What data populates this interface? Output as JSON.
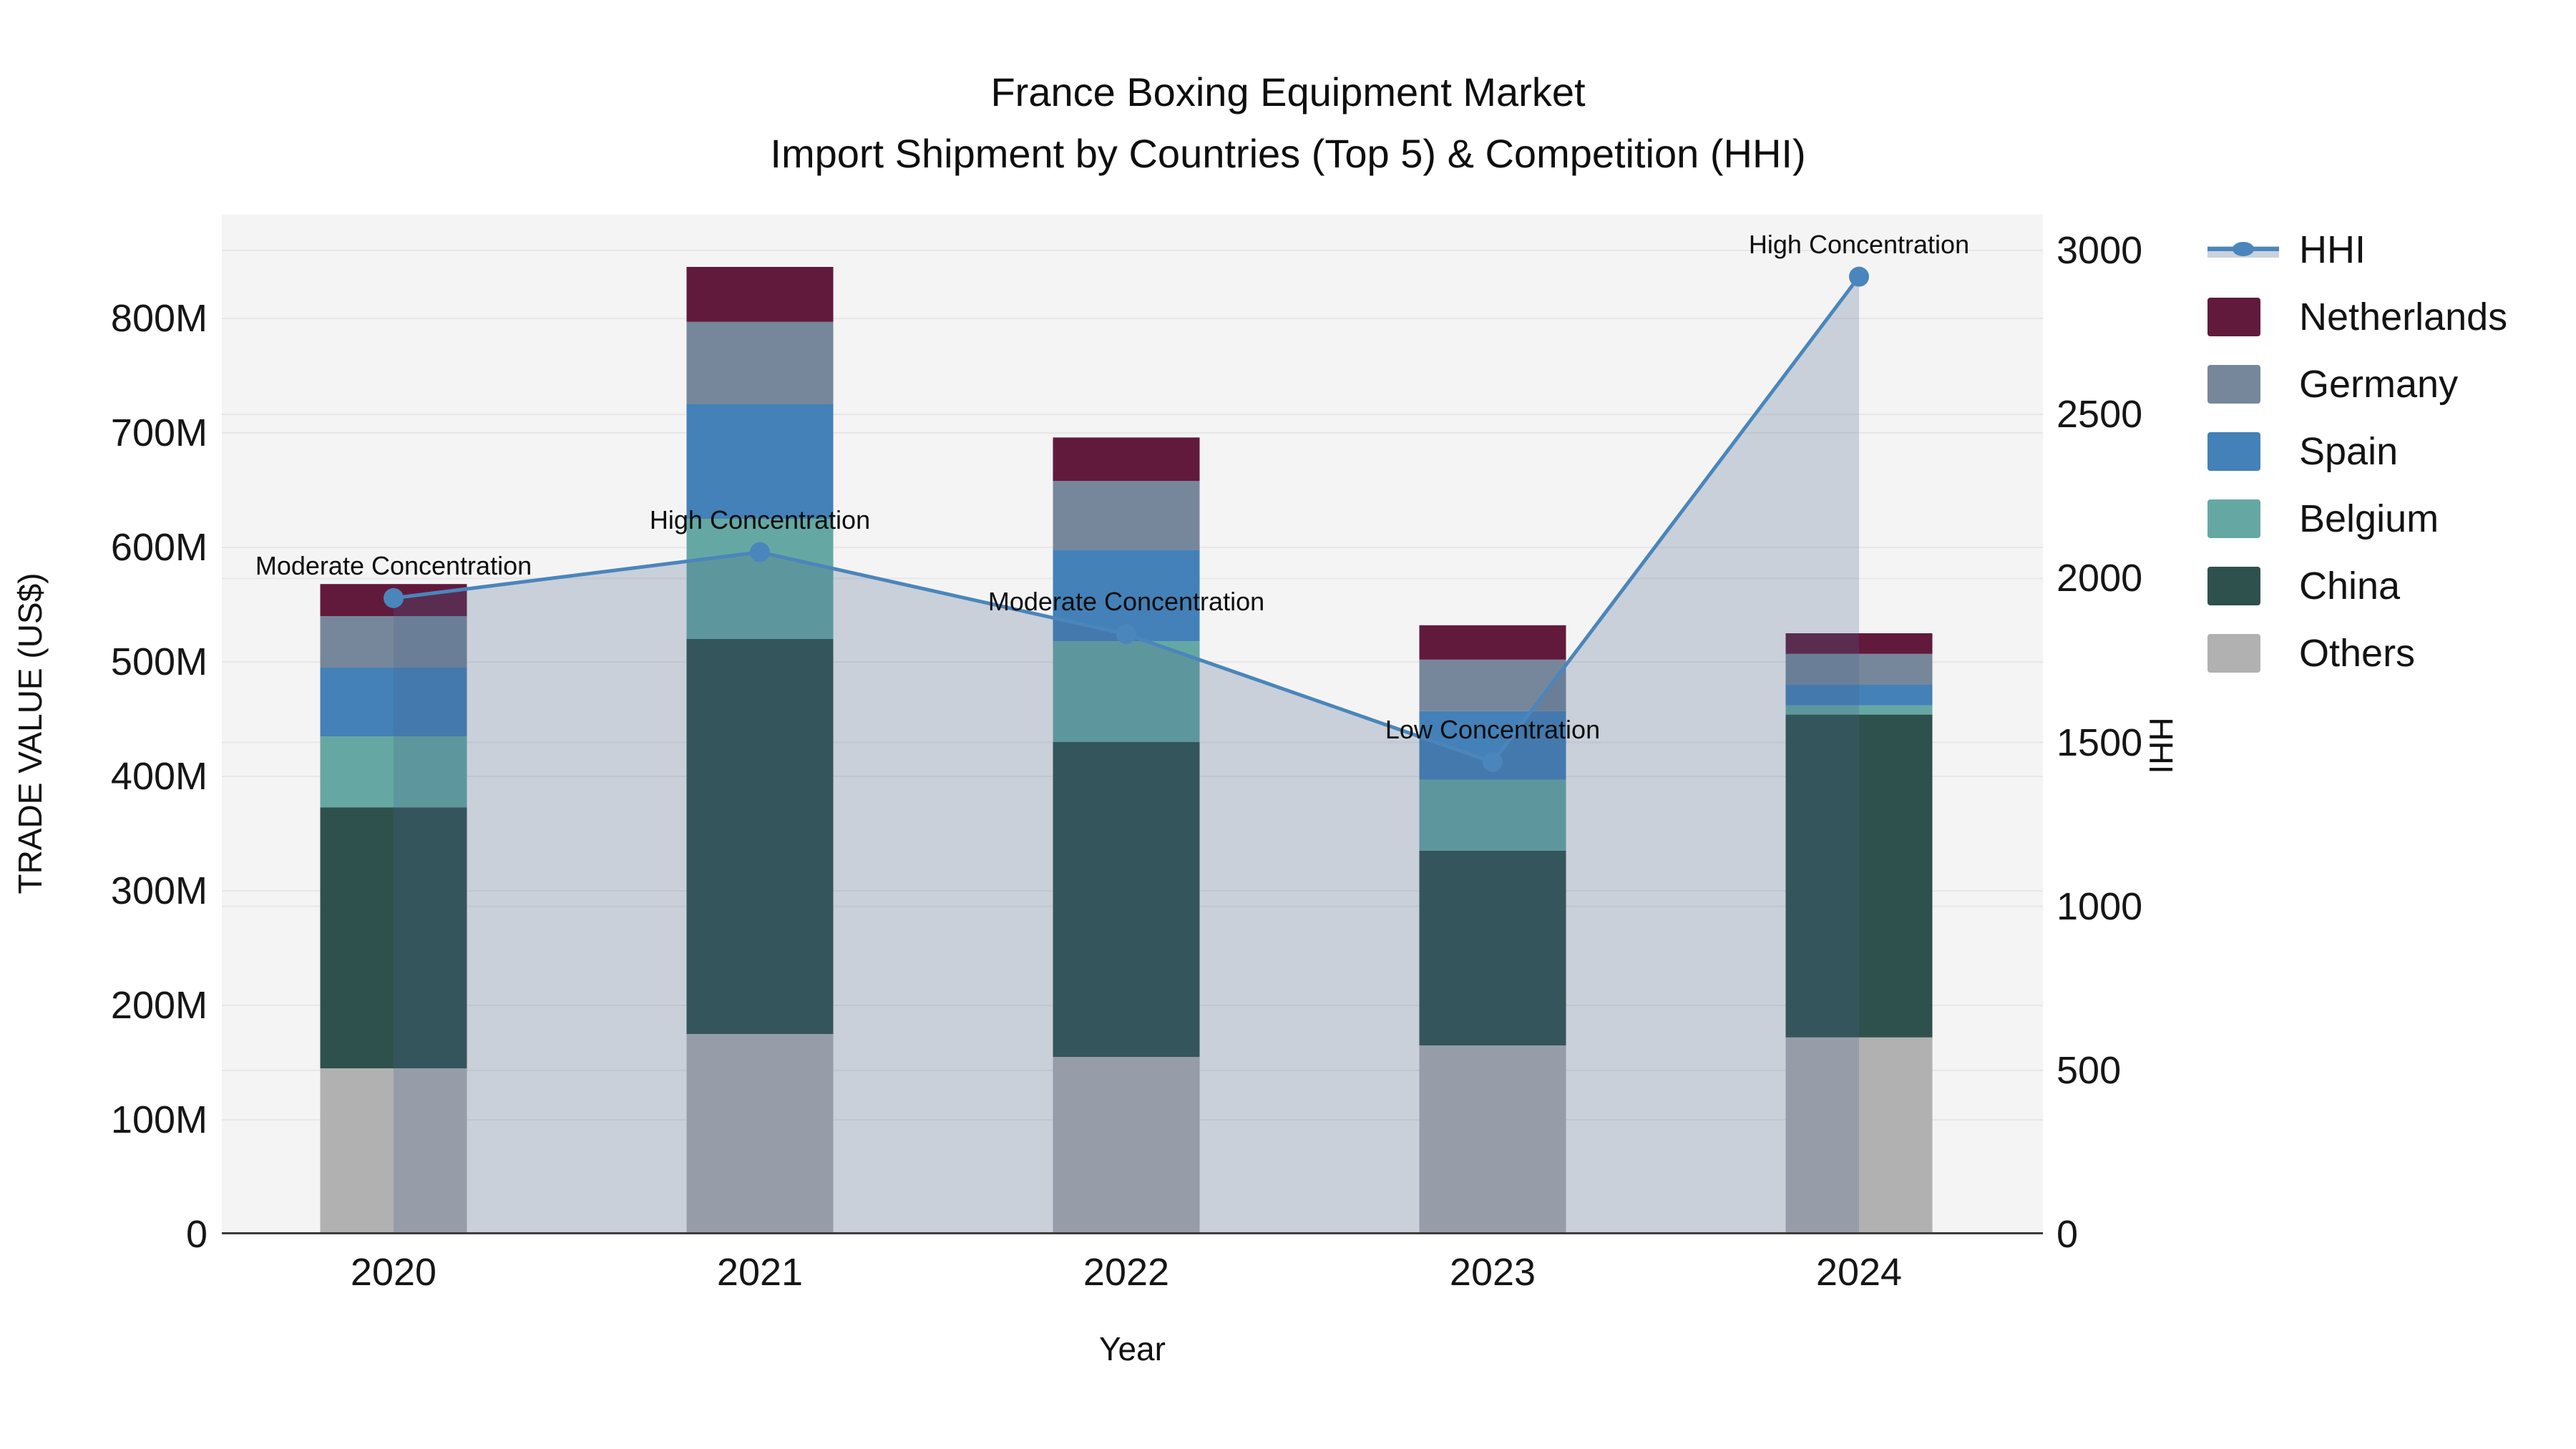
{
  "title": {
    "line1": "France Boxing Equipment Market",
    "line2": "Import Shipment by Countries (Top 5) & Competition (HHI)"
  },
  "chart_data": {
    "type": "bar",
    "subtype": "stacked-bars-with-line-overlay",
    "categories": [
      "2020",
      "2021",
      "2022",
      "2023",
      "2024"
    ],
    "bar_unit": "Million US$",
    "series": [
      {
        "name": "Others",
        "color": "#B1B1B2",
        "values": [
          145,
          175,
          155,
          165,
          172
        ]
      },
      {
        "name": "China",
        "color": "#2F514D",
        "values": [
          228,
          345,
          275,
          170,
          282
        ]
      },
      {
        "name": "Belgium",
        "color": "#65A8A3",
        "values": [
          62,
          105,
          88,
          62,
          8
        ]
      },
      {
        "name": "Spain",
        "color": "#4381B8",
        "values": [
          60,
          100,
          80,
          60,
          18
        ]
      },
      {
        "name": "Germany",
        "color": "#77879B",
        "values": [
          45,
          72,
          60,
          45,
          27
        ]
      },
      {
        "name": "Netherlands",
        "color": "#611A3C",
        "values": [
          28,
          48,
          38,
          30,
          18
        ]
      }
    ],
    "bar_totals": [
      568,
      845,
      696,
      532,
      525
    ],
    "line_series": {
      "name": "HHI",
      "axis": "right",
      "color": "#4A86BB",
      "area_fill_color": "rgba(70,100,140,0.25)",
      "values": [
        1940,
        2080,
        1830,
        1440,
        2920
      ]
    },
    "annotations": [
      {
        "category": "2020",
        "text": "Moderate Concentration"
      },
      {
        "category": "2021",
        "text": "High Concentration"
      },
      {
        "category": "2022",
        "text": "Moderate Concentration"
      },
      {
        "category": "2023",
        "text": "Low Concentration"
      },
      {
        "category": "2024",
        "text": "High Concentration"
      }
    ],
    "y_left": {
      "title": "TRADE VALUE (US$)",
      "tick_labels": [
        "0",
        "100M",
        "200M",
        "300M",
        "400M",
        "500M",
        "600M",
        "700M",
        "800M"
      ],
      "tick_values": [
        0,
        100,
        200,
        300,
        400,
        500,
        600,
        700,
        800
      ],
      "range_millions": [
        0,
        890
      ]
    },
    "y_right": {
      "title": "HHI",
      "tick_labels": [
        "0",
        "500",
        "1000",
        "1500",
        "2000",
        "2500",
        "3000"
      ],
      "tick_values": [
        0,
        500,
        1000,
        1500,
        2000,
        2500,
        3000
      ],
      "range": [
        0,
        3109
      ]
    },
    "x_axis": {
      "title": "Year"
    },
    "grid": "on",
    "legend_position": "right",
    "legend": [
      {
        "label": "HHI",
        "symbol": "line",
        "color": "#4A86BB",
        "band_color": "#C9D2DD"
      },
      {
        "label": "Netherlands",
        "symbol": "square",
        "color": "#611A3C"
      },
      {
        "label": "Germany",
        "symbol": "square",
        "color": "#77879B"
      },
      {
        "label": "Spain",
        "symbol": "square",
        "color": "#4381B8"
      },
      {
        "label": "Belgium",
        "symbol": "square",
        "color": "#65A8A3"
      },
      {
        "label": "China",
        "symbol": "square",
        "color": "#2F514D"
      },
      {
        "label": "Others",
        "symbol": "square",
        "color": "#B1B1B2"
      }
    ],
    "plot_background": "#F4F4F4",
    "gridline_color": "#E7E7E7",
    "baseline_color": "#3D3D3D"
  }
}
